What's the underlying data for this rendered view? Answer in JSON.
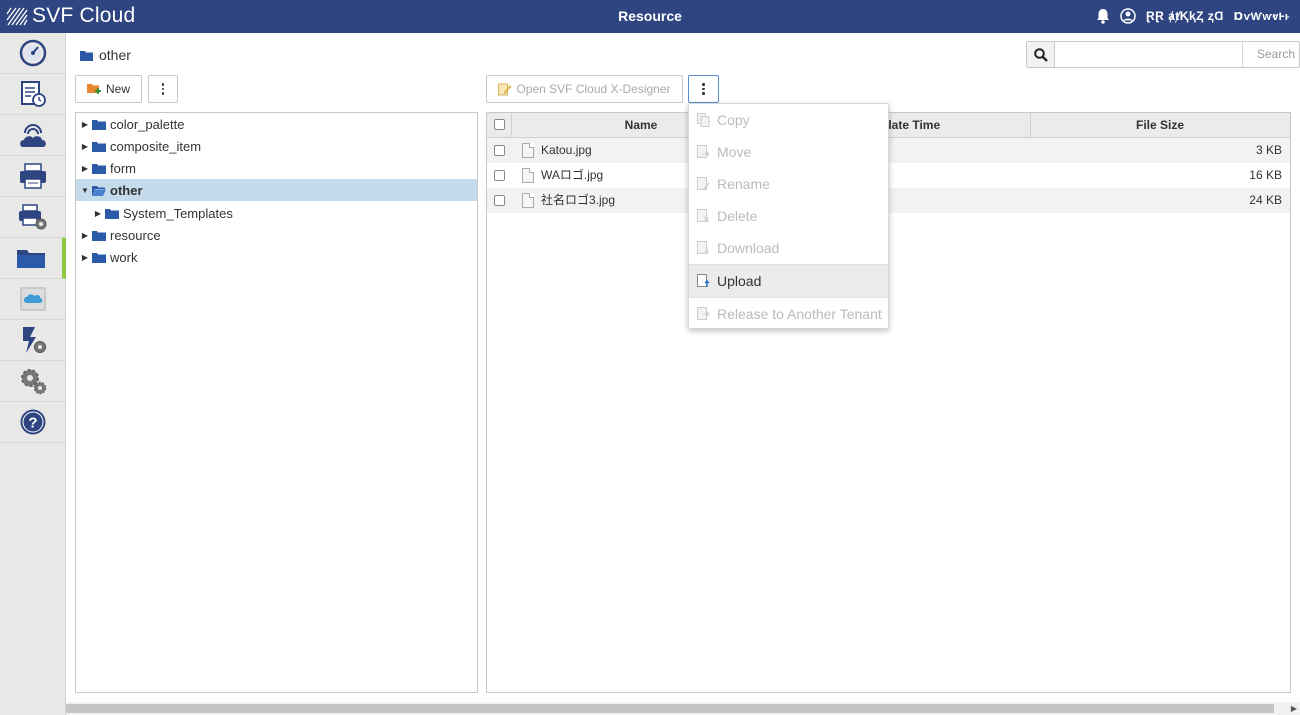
{
  "app": {
    "logo_text": "SVF Cloud",
    "title": "Resource",
    "user_name": "ⱤⱤ ⱥⱦⱩⱪⱫ ⱬⱭ",
    "tenant_name": "ⱰⱱⱲⱳⱴⱵⱶ"
  },
  "colors": {
    "header": "#2e4582",
    "accent": "#8dc63f",
    "selection": "#c3dbea",
    "folder": "#2b5aa8"
  },
  "sidebar": {
    "items": [
      {
        "icon": "dashboard-icon"
      },
      {
        "icon": "log-history-icon"
      },
      {
        "icon": "cloud-connect-icon"
      },
      {
        "icon": "printer-icon"
      },
      {
        "icon": "printer-settings-icon"
      },
      {
        "icon": "folder-icon",
        "active": true
      },
      {
        "icon": "salesforce-icon"
      },
      {
        "icon": "action-settings-icon"
      },
      {
        "icon": "settings-gears-icon"
      },
      {
        "icon": "help-icon"
      }
    ]
  },
  "breadcrumb": {
    "current": "other"
  },
  "search": {
    "placeholder": "",
    "label": "Search"
  },
  "toolbar": {
    "new_label": "New",
    "open_designer_label": "Open SVF Cloud X-Designer"
  },
  "tree": {
    "items": [
      {
        "label": "color_palette",
        "expanded": false,
        "level": 0
      },
      {
        "label": "composite_item",
        "expanded": false,
        "level": 0
      },
      {
        "label": "form",
        "expanded": false,
        "level": 0
      },
      {
        "label": "other",
        "expanded": true,
        "level": 0,
        "selected": true
      },
      {
        "label": "System_Templates",
        "expanded": false,
        "level": 1
      },
      {
        "label": "resource",
        "expanded": false,
        "level": 0
      },
      {
        "label": "work",
        "expanded": false,
        "level": 0
      }
    ]
  },
  "table": {
    "columns": [
      "Name",
      "Update Time",
      "File Size"
    ],
    "update_time_visible": "pdate Time",
    "rows": [
      {
        "name": "Katou.jpg",
        "size": "3 KB"
      },
      {
        "name": "WAロゴ.jpg",
        "size": "16 KB"
      },
      {
        "name": "社名ロゴ3.jpg",
        "size": "24 KB"
      }
    ]
  },
  "menu": {
    "items": [
      {
        "label": "Copy",
        "enabled": false
      },
      {
        "label": "Move",
        "enabled": false
      },
      {
        "label": "Rename",
        "enabled": false
      },
      {
        "label": "Delete",
        "enabled": false
      },
      {
        "label": "Download",
        "enabled": false
      },
      {
        "label": "Upload",
        "enabled": true
      },
      {
        "label": "Release to Another Tenant",
        "enabled": false
      }
    ]
  }
}
